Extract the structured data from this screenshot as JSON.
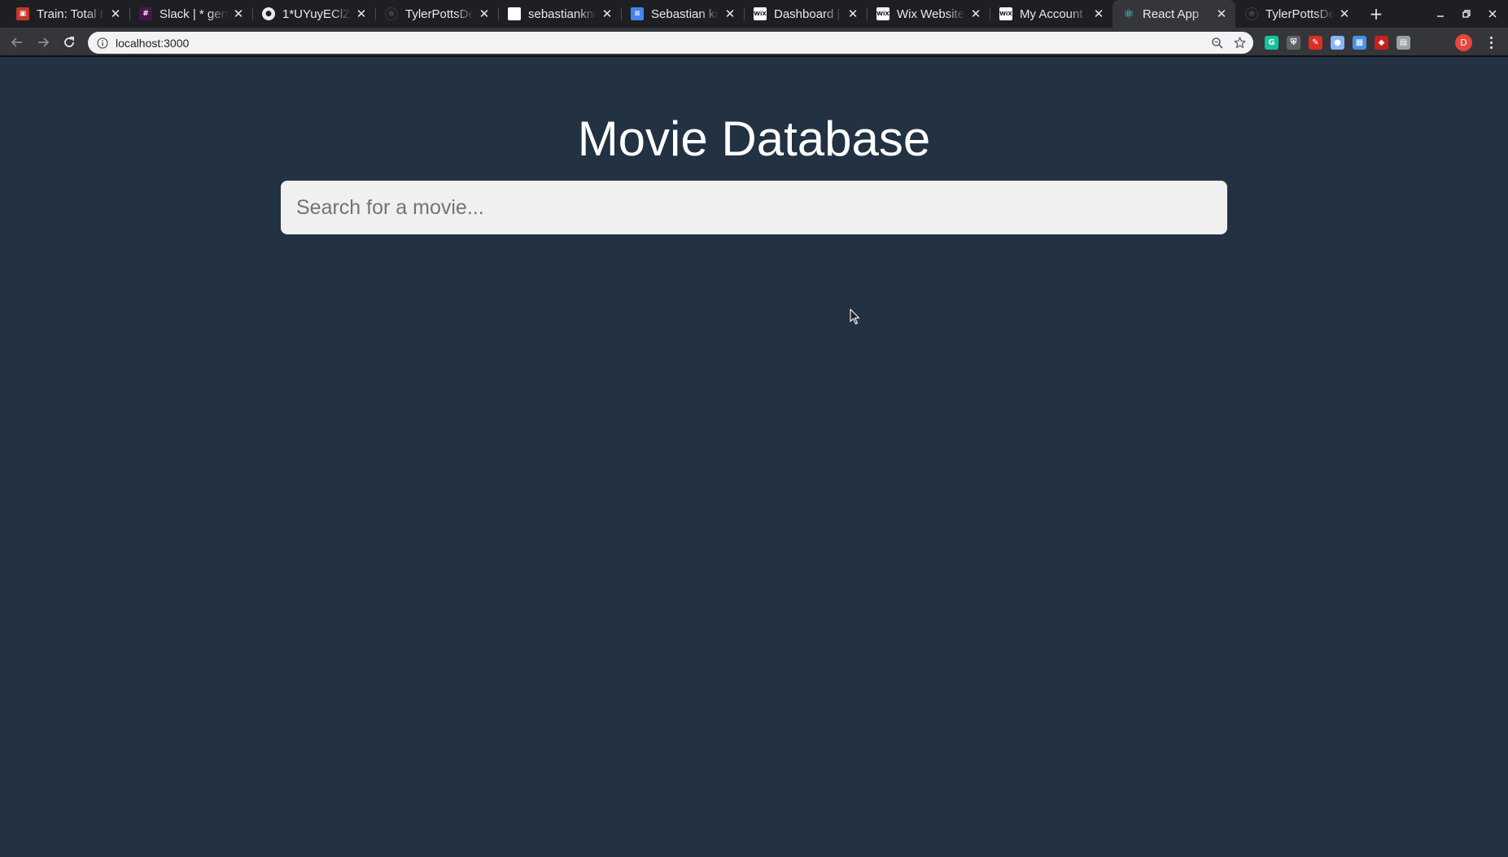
{
  "browser": {
    "tabs": [
      {
        "title": "Train: Total I",
        "icon": "ecto-icon",
        "color": "#c0392b",
        "glyph": "▣",
        "active": false
      },
      {
        "title": "Slack | * gene",
        "icon": "slack-icon",
        "color": "#4a154b",
        "glyph": "#",
        "active": false
      },
      {
        "title": "1*UYuyEClZu",
        "icon": "globe-icon",
        "color": "#e8eaed",
        "glyph": "●",
        "active": false
      },
      {
        "title": "TylerPottsDe",
        "icon": "github-icon",
        "color": "#1e1f22",
        "glyph": "●",
        "active": false
      },
      {
        "title": "sebastiankno",
        "icon": "page-icon",
        "color": "#ffffff",
        "glyph": "",
        "active": false
      },
      {
        "title": "Sebastian kn",
        "icon": "google-docs-icon",
        "color": "#4285f4",
        "glyph": "≡",
        "active": false
      },
      {
        "title": "Dashboard |",
        "icon": "wix-icon",
        "color": "#ffffff",
        "glyph": "WiX",
        "active": false
      },
      {
        "title": "Wix Website",
        "icon": "wix-icon",
        "color": "#ffffff",
        "glyph": "WiX",
        "active": false
      },
      {
        "title": "My Account |",
        "icon": "wix-icon",
        "color": "#ffffff",
        "glyph": "WiX",
        "active": false
      },
      {
        "title": "React App",
        "icon": "react-icon",
        "color": "#61dafb",
        "glyph": "⚛",
        "active": true
      },
      {
        "title": "TylerPottsDe",
        "icon": "github-icon",
        "color": "#1e1f22",
        "glyph": "●",
        "active": false
      }
    ],
    "url": "localhost:3000",
    "profile_initial": "D",
    "extensions": [
      {
        "icon": "grammarly-icon",
        "color": "#15c39a",
        "glyph": "G"
      },
      {
        "icon": "shield-extension-icon",
        "color": "#5f6368",
        "glyph": "⛨"
      },
      {
        "icon": "pen-extension-icon",
        "color": "#d93025",
        "glyph": "✎"
      },
      {
        "icon": "circle-extension-icon",
        "color": "#8ab4f8",
        "glyph": "●"
      },
      {
        "icon": "photo-extension-icon",
        "color": "#4a90e2",
        "glyph": "▦"
      },
      {
        "icon": "red-extension-icon",
        "color": "#c5221f",
        "glyph": "◆"
      },
      {
        "icon": "grey-extension-icon",
        "color": "#9aa0a6",
        "glyph": "▤"
      }
    ]
  },
  "app": {
    "title": "Movie Database",
    "search_placeholder": "Search for a movie..."
  },
  "colors": {
    "page_background": "#223243",
    "title_text": "#ffffff",
    "search_background": "#f0f0f0"
  }
}
